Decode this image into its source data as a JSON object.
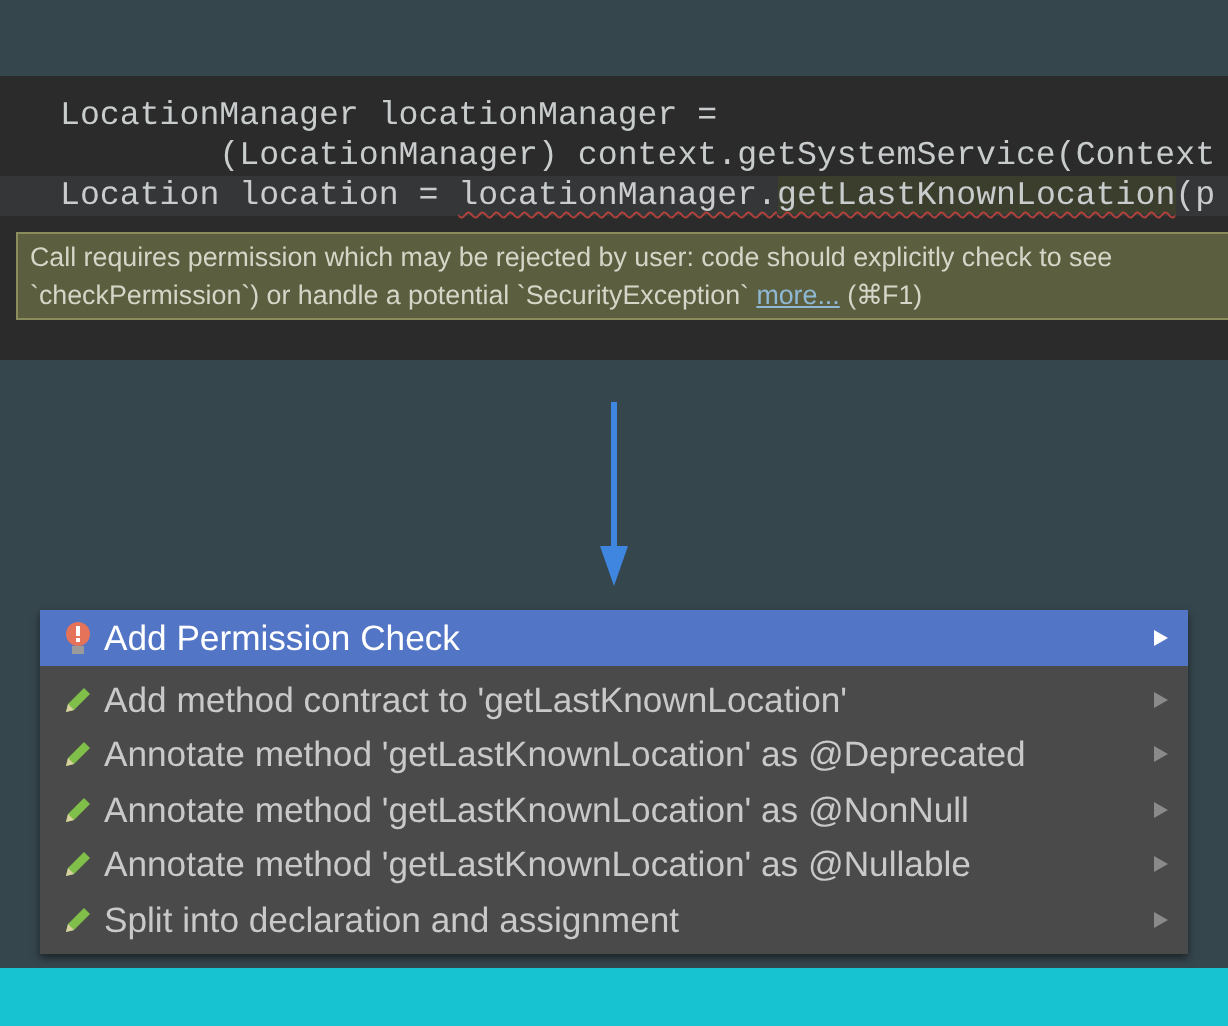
{
  "editor": {
    "lines": [
      {
        "current": false,
        "segments": [
          {
            "kind": "plain",
            "text": "LocationManager locationManager ="
          }
        ]
      },
      {
        "current": false,
        "segments": [
          {
            "kind": "plain",
            "text": "        (LocationManager) context.getSystemService(Context"
          }
        ]
      },
      {
        "current": true,
        "segments": [
          {
            "kind": "plain",
            "text": "Location location = "
          },
          {
            "kind": "error",
            "text": "locationManager."
          },
          {
            "kind": "warning",
            "text": "getLastKnownLocation"
          },
          {
            "kind": "plain",
            "text": "(p"
          }
        ]
      }
    ],
    "tooltip": {
      "line_1": "Call requires permission which may be rejected by user: code should explicitly check to see",
      "line_2": "`checkPermission`) or handle a potential `SecurityException`",
      "link": "more...",
      "shortcut": "(⌘F1)"
    }
  },
  "menu": {
    "items": [
      {
        "kind": "bulb",
        "label": "Add Permission Check",
        "selected": true
      },
      {
        "kind": "pencil",
        "label": "Add method contract to 'getLastKnownLocation'",
        "selected": false
      },
      {
        "kind": "pencil",
        "label": "Annotate method 'getLastKnownLocation' as @Deprecated",
        "selected": false
      },
      {
        "kind": "pencil",
        "label": "Annotate method 'getLastKnownLocation' as @NonNull",
        "selected": false
      },
      {
        "kind": "pencil",
        "label": "Annotate method 'getLastKnownLocation' as @Nullable",
        "selected": false
      },
      {
        "kind": "pencil",
        "label": "Split into declaration and assignment",
        "selected": false
      }
    ]
  }
}
